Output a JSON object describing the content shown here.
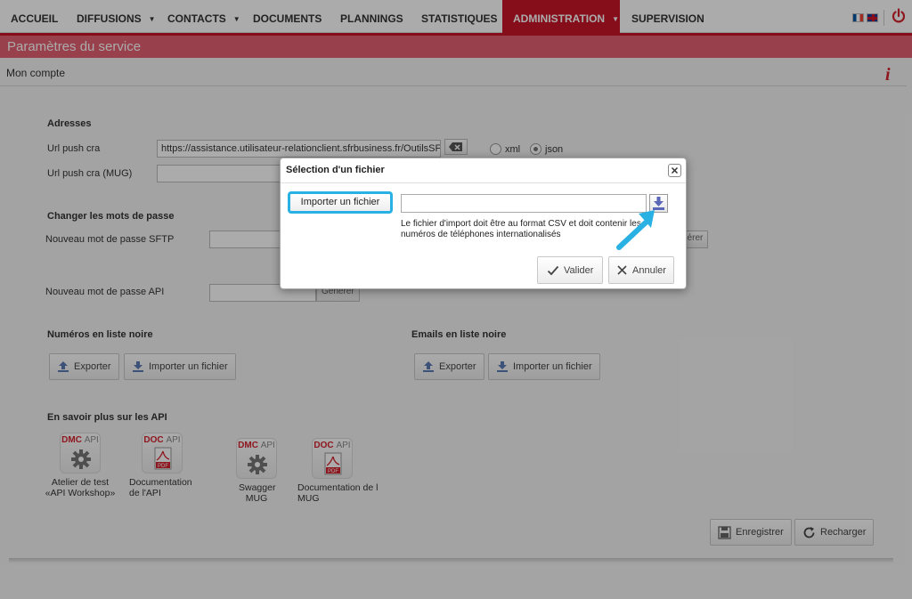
{
  "nav": {
    "items": [
      {
        "label": "ACCUEIL",
        "caret": false
      },
      {
        "label": "DIFFUSIONS",
        "caret": true
      },
      {
        "label": "CONTACTS",
        "caret": true
      },
      {
        "label": "DOCUMENTS",
        "caret": false
      },
      {
        "label": "PLANNINGS",
        "caret": false
      },
      {
        "label": "STATISTIQUES",
        "caret": false
      },
      {
        "label": "ADMINISTRATION",
        "caret": true,
        "active": true
      },
      {
        "label": "SUPERVISION",
        "caret": false
      }
    ],
    "accent_color": "#c81427"
  },
  "page": {
    "title": "Paramètres du service",
    "subtitle": "Mon compte"
  },
  "addresses": {
    "heading": "Adresses",
    "url_push_label": "Url push cra",
    "url_push_value": "https://assistance.utilisateur-relationclient.sfrbusiness.fr/OutilsSF",
    "url_push_mug_label": "Url push cra (MUG)",
    "url_push_mug_value": "",
    "format_xml": "xml",
    "format_json": "json",
    "format_selected": "json"
  },
  "passwords": {
    "heading": "Changer les mots de passe",
    "sftp_label": "Nouveau mot de passe SFTP",
    "api_label": "Nouveau mot de passe API",
    "generate_label": "Générer",
    "generate_partial": "nérer"
  },
  "blacklist_numbers": {
    "heading": "Numéros en liste noire",
    "export_label": "Exporter",
    "import_label": "Importer un fichier"
  },
  "blacklist_emails": {
    "heading": "Emails en liste noire",
    "export_label": "Exporter",
    "import_label": "Importer un fichier"
  },
  "api": {
    "heading": "En savoir plus sur les API",
    "cards": [
      {
        "tag_main": "DMC",
        "tag_sub": "API",
        "icon": "gear-icon",
        "caption": "Atelier de test «API Workshop»"
      },
      {
        "tag_main": "DOC",
        "tag_sub": "API",
        "icon": "pdf-icon",
        "caption": "Documentation de l'API"
      },
      {
        "tag_main": "DMC",
        "tag_sub": "API",
        "icon": "gear-icon",
        "caption": "Swagger MUG"
      },
      {
        "tag_main": "DOC",
        "tag_sub": "API",
        "icon": "pdf-icon",
        "caption": "Documentation de l MUG"
      }
    ]
  },
  "footer": {
    "save_label": "Enregistrer",
    "reload_label": "Recharger"
  },
  "modal": {
    "title": "Sélection d'un fichier",
    "import_label": "Importer un fichier",
    "file_value": "",
    "help_text": "Le fichier d'import doit être au format CSV et doit contenir les numéros de téléphones internationalisés",
    "validate_label": "Valider",
    "cancel_label": "Annuler",
    "highlight_color": "#2ab1e4"
  }
}
